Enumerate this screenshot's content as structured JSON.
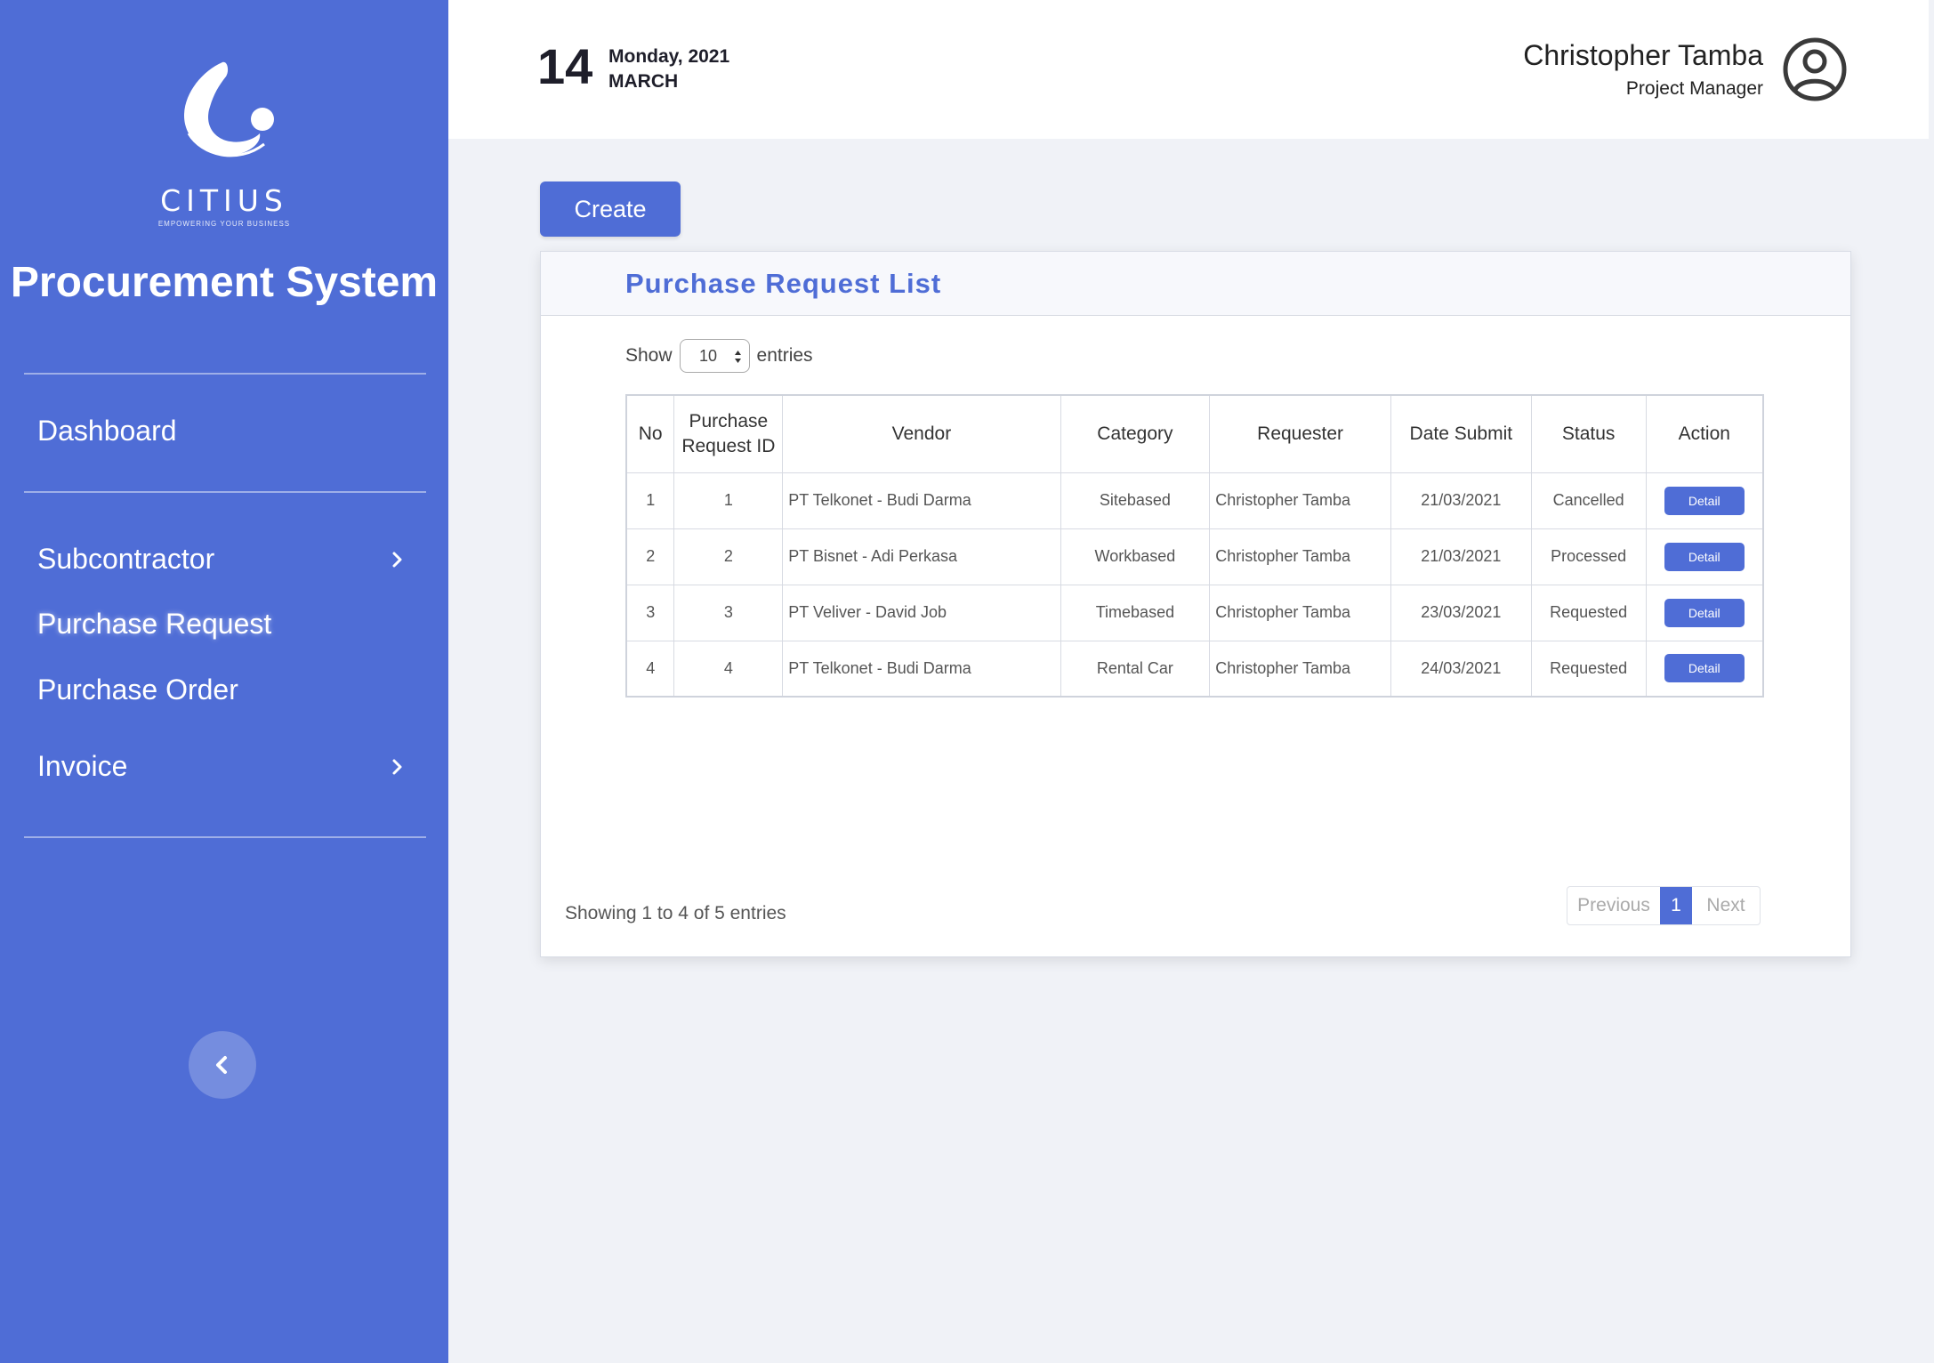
{
  "sidebar": {
    "logo_word": "CITIUS",
    "logo_tagline": "EMPOWERING YOUR BUSINESS",
    "app_title": "Procurement System",
    "items": [
      {
        "label": "Dashboard"
      },
      {
        "label": "Subcontractor"
      },
      {
        "label": "Purchase Request"
      },
      {
        "label": "Purchase Order"
      },
      {
        "label": "Invoice"
      }
    ],
    "icons": [
      "chevron-right-icon",
      "chevron-left-icon"
    ]
  },
  "header": {
    "day": "14",
    "weekday_year": "Monday, 2021",
    "month": "MARCH",
    "user_name": "Christopher Tamba",
    "user_role": "Project Manager"
  },
  "toolbar": {
    "create_label": "Create"
  },
  "card": {
    "title": "Purchase Request List",
    "show_label": "Show",
    "entries_value": "10",
    "entries_label": "entries",
    "columns": [
      "No",
      "Purchase Request ID",
      "Vendor",
      "Category",
      "Requester",
      "Date Submit",
      "Status",
      "Action"
    ],
    "rows": [
      {
        "no": "1",
        "id": "1",
        "vendor": "PT Telkonet - Budi Darma",
        "category": "Sitebased",
        "requester": "Christopher Tamba",
        "date": "21/03/2021",
        "status": "Cancelled",
        "action": "Detail"
      },
      {
        "no": "2",
        "id": "2",
        "vendor": "PT Bisnet - Adi Perkasa",
        "category": "Workbased",
        "requester": "Christopher Tamba",
        "date": "21/03/2021",
        "status": "Processed",
        "action": "Detail"
      },
      {
        "no": "3",
        "id": "3",
        "vendor": "PT Veliver - David Job",
        "category": "Timebased",
        "requester": "Christopher Tamba",
        "date": "23/03/2021",
        "status": "Requested",
        "action": "Detail"
      },
      {
        "no": "4",
        "id": "4",
        "vendor": "PT Telkonet - Budi Darma",
        "category": "Rental Car",
        "requester": "Christopher Tamba",
        "date": "24/03/2021",
        "status": "Requested",
        "action": "Detail"
      }
    ],
    "info_text": "Showing 1 to 4 of 5 entries",
    "pagination": {
      "previous": "Previous",
      "current": "1",
      "next": "Next"
    }
  },
  "colors": {
    "accent": "#4f6dd6",
    "background": "#f0f2f7"
  }
}
